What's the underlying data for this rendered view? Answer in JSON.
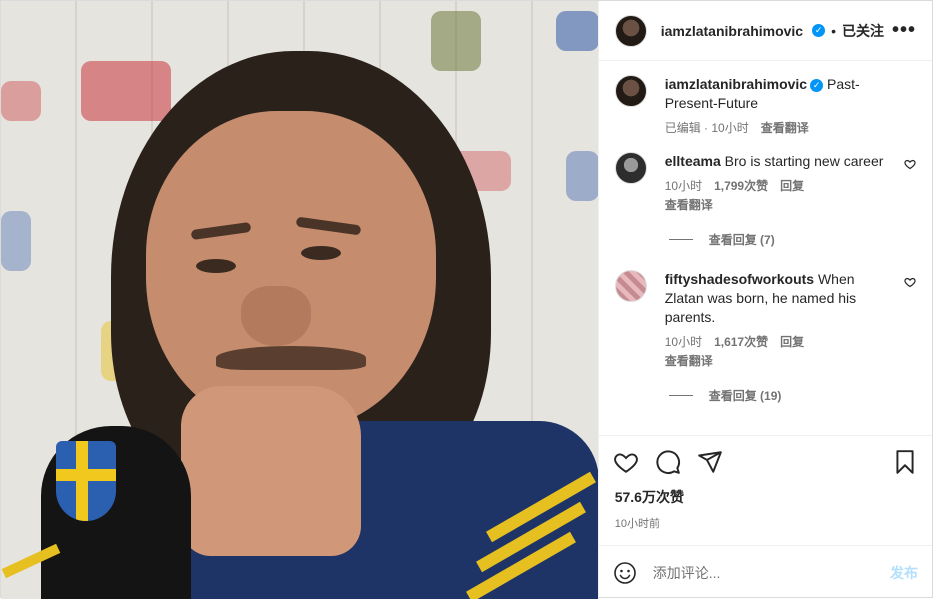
{
  "header": {
    "username": "iamzlatanibrahimovic",
    "separator": "•",
    "follow_status": "已关注",
    "more": "•••"
  },
  "caption": {
    "username": "iamzlatanibrahimovic",
    "text": "Past-Present-Future",
    "edited": "已编辑 · 10小时",
    "translate": "查看翻译"
  },
  "comments": [
    {
      "username": "ellteama",
      "text": "Bro is starting new career",
      "time": "10小时",
      "likes": "1,799次赞",
      "reply": "回复",
      "translate": "查看翻译",
      "view_replies": "查看回复 (7)"
    },
    {
      "username": "fiftyshadesofworkouts",
      "text": "When Zlatan was born, he named his parents.",
      "time": "10小时",
      "likes": "1,617次赞",
      "reply": "回复",
      "translate": "查看翻译",
      "view_replies": "查看回复 (19)"
    }
  ],
  "stats": {
    "likes": "57.6万次赞",
    "posted": "10小时前"
  },
  "add_comment": {
    "placeholder": "添加评论...",
    "post_label": "发布"
  },
  "icons": {
    "like": "heart-icon",
    "comment": "comment-icon",
    "share": "share-icon",
    "save": "bookmark-icon",
    "emoji": "emoji-icon",
    "verified": "verified-badge-icon"
  },
  "colors": {
    "verified": "#0095f6",
    "post_disabled": "#b2dffc",
    "meta": "#737373"
  }
}
